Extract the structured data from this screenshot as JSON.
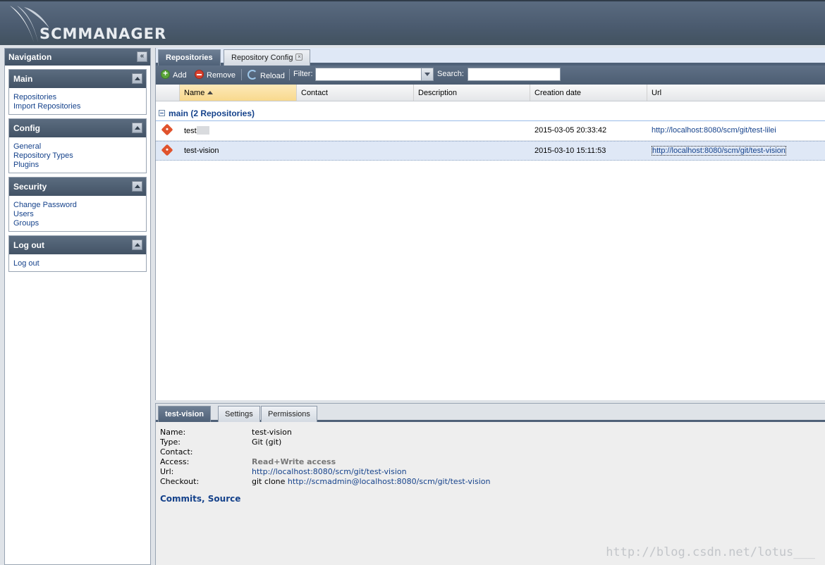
{
  "app": {
    "logo_text": "SCMMANAGER"
  },
  "navigation": {
    "title": "Navigation",
    "panels": [
      {
        "title": "Main",
        "links": [
          "Repositories",
          "Import Repositories"
        ]
      },
      {
        "title": "Config",
        "links": [
          "General",
          "Repository Types",
          "Plugins"
        ]
      },
      {
        "title": "Security",
        "links": [
          "Change Password",
          "Users",
          "Groups"
        ]
      },
      {
        "title": "Log out",
        "links": [
          "Log out"
        ]
      }
    ]
  },
  "tabs": [
    {
      "label": "Repositories",
      "active": true
    },
    {
      "label": "Repository Config",
      "active": false
    }
  ],
  "toolbar": {
    "add_label": "Add",
    "remove_label": "Remove",
    "reload_label": "Reload",
    "filter_label": "Filter:",
    "filter_value": "",
    "search_label": "Search:",
    "search_value": ""
  },
  "grid": {
    "columns": [
      "Name",
      "Contact",
      "Description",
      "Creation date",
      "Url"
    ],
    "sorted_column": "Name",
    "group_label": "main (2 Repositories)",
    "rows": [
      {
        "name": "test",
        "name_redacted": true,
        "contact": "",
        "description": "",
        "creation_date": "2015-03-05 20:33:42",
        "url": "http://localhost:8080/scm/git/test-lilei",
        "selected": false
      },
      {
        "name": "test-vision",
        "name_redacted": false,
        "contact": "",
        "description": "",
        "creation_date": "2015-03-10 15:11:53",
        "url": "http://localhost:8080/scm/git/test-vision",
        "selected": true
      }
    ]
  },
  "detail": {
    "tabs": [
      "test-vision",
      "Settings",
      "Permissions"
    ],
    "fields": {
      "name_label": "Name:",
      "name": "test-vision",
      "type_label": "Type:",
      "type": "Git (git)",
      "contact_label": "Contact:",
      "contact": "",
      "access_label": "Access:",
      "access": "Read+Write access",
      "url_label": "Url:",
      "url": "http://localhost:8080/scm/git/test-vision",
      "checkout_label": "Checkout:",
      "checkout_cmd": "git clone",
      "checkout_url": "http://scmadmin@localhost:8080/scm/git/test-vision"
    },
    "links": "Commits, Source"
  },
  "watermark": "http://blog.csdn.net/lotus___",
  "colors": {
    "header": "#4a5a6e",
    "link": "#15428b",
    "selected_row": "#dfe8f6",
    "sorted_header": "#f8d98d"
  }
}
